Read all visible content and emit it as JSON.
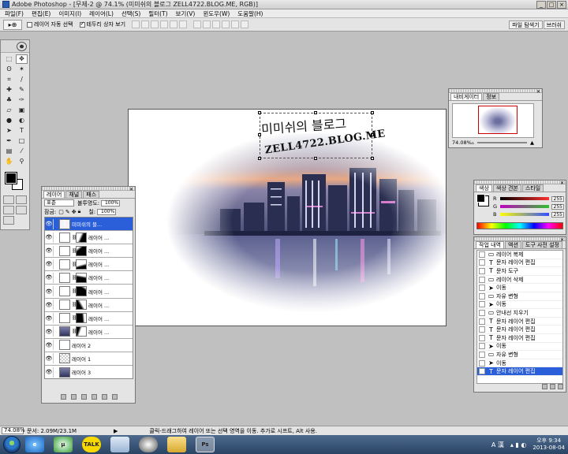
{
  "window": {
    "title": "Adobe Photoshop - [무제-2 @ 74.1% (미미쉬의 블로그 ZELL4722.BLOG.ME, RGB)]",
    "controls": [
      "_",
      "□",
      "×"
    ]
  },
  "menu": [
    "파일(F)",
    "편집(E)",
    "이미지(I)",
    "레이어(L)",
    "선택(S)",
    "필터(T)",
    "보기(V)",
    "윈도우(W)",
    "도움말(H)"
  ],
  "options": {
    "tool_preset": "▸⊕",
    "auto_select_label": "레이어 자동 선택",
    "auto_select_checked": false,
    "show_bounds_label": "테두리 상자 보기",
    "show_bounds_checked": true
  },
  "palette_well": [
    "파일 탐색기",
    "브러쉬"
  ],
  "document": {
    "text_korean": "미미쉬의 블로그",
    "text_url": "ZELL4722.BLOG.ME"
  },
  "navigator": {
    "tabs": [
      "내비게이터",
      "정보"
    ],
    "zoom": "74.08%"
  },
  "color": {
    "tabs": [
      "색상",
      "색상 견본",
      "스타일"
    ],
    "channels": [
      {
        "label": "R",
        "value": "255",
        "color": "#ff3030"
      },
      {
        "label": "G",
        "value": "255",
        "color": "#30c030"
      },
      {
        "label": "B",
        "value": "255",
        "color": "#3050ff"
      }
    ]
  },
  "history": {
    "tabs": [
      "작업 내역",
      "액션",
      "도구 사전 설정"
    ],
    "items": [
      {
        "icon": "layer",
        "label": "레이어 복제"
      },
      {
        "icon": "text",
        "label": "문자 레이어 편집"
      },
      {
        "icon": "text",
        "label": "문자 도구"
      },
      {
        "icon": "layer",
        "label": "레이어 삭제"
      },
      {
        "icon": "move",
        "label": "이동"
      },
      {
        "icon": "layer",
        "label": "자유 변형"
      },
      {
        "icon": "move",
        "label": "이동"
      },
      {
        "icon": "layer",
        "label": "안내선 지우기"
      },
      {
        "icon": "text",
        "label": "문자 레이어 편집"
      },
      {
        "icon": "text",
        "label": "문자 레이어 편집"
      },
      {
        "icon": "text",
        "label": "문자 레이어 편집"
      },
      {
        "icon": "move",
        "label": "이동"
      },
      {
        "icon": "layer",
        "label": "자유 변형"
      },
      {
        "icon": "move",
        "label": "이동"
      },
      {
        "icon": "text",
        "label": "문자 레이어 편집"
      }
    ],
    "selected_index": 14
  },
  "layers": {
    "tabs": [
      "레이어",
      "채널",
      "패스"
    ],
    "blend_mode": "표준",
    "opacity_label": "불투명도:",
    "opacity": "100%",
    "lock_label": "잠금:",
    "fill_label": "칠:",
    "fill": "100%",
    "items": [
      {
        "kind": "text",
        "name": "미미쉬의 블...",
        "selected": true
      },
      {
        "kind": "mask",
        "name": "레이어 ..."
      },
      {
        "kind": "mask",
        "name": "레이어 ..."
      },
      {
        "kind": "mask",
        "name": "레이어 ..."
      },
      {
        "kind": "mask",
        "name": "레이어 ..."
      },
      {
        "kind": "mask",
        "name": "레이어 ..."
      },
      {
        "kind": "mask",
        "name": "레이어 ..."
      },
      {
        "kind": "mask",
        "name": "레이어 ..."
      },
      {
        "kind": "photo-mask",
        "name": "레이어 ..."
      },
      {
        "kind": "blank",
        "name": "레이어 2"
      },
      {
        "kind": "check",
        "name": "레이어 1"
      },
      {
        "kind": "photo",
        "name": "레이어 3"
      }
    ]
  },
  "status": {
    "zoom": "74.08%",
    "doc_size": "문서: 2.09M/23.1M",
    "hint": "클릭-드래그하여 레이어 또는 선택 영역을 이동. 추가로 시프트, Alt 사용."
  },
  "taskbar": {
    "ime": "A 漢",
    "time": "오후 9:34",
    "date": "2013-08-04",
    "apps": [
      "e",
      "µ",
      "TALK",
      "",
      "",
      "",
      "Ps"
    ]
  }
}
